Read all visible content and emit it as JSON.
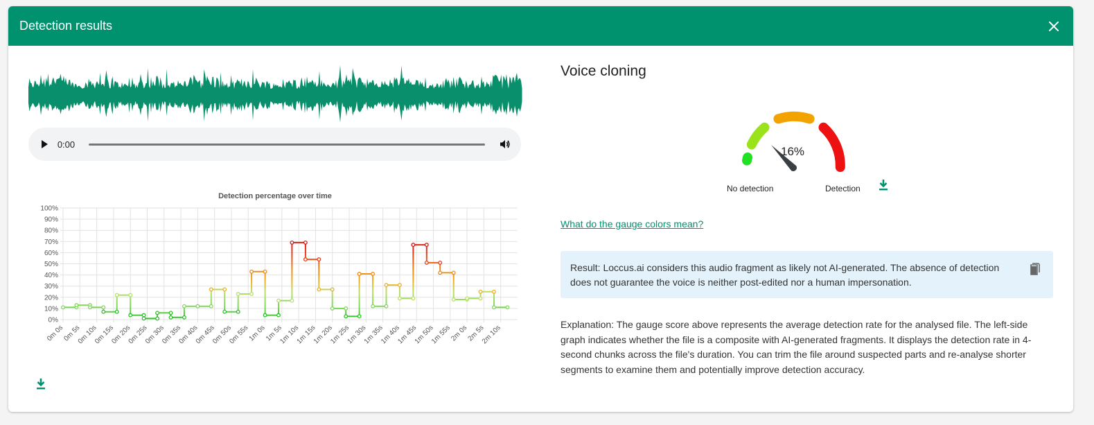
{
  "header": {
    "title": "Detection results",
    "close_icon": "close-icon"
  },
  "audio": {
    "time": "0:00",
    "play_icon": "play-icon",
    "volume_icon": "volume-icon",
    "progress": 0
  },
  "colors": {
    "brand": "#00916e",
    "waveform": "#0a8f6c",
    "result_bg": "#e3f2fb"
  },
  "chart_data": {
    "type": "line",
    "title": "Detection percentage over time",
    "xlabel": "",
    "ylabel": "",
    "ylim": [
      0,
      100
    ],
    "y_ticks": [
      "0%",
      "10%",
      "20%",
      "30%",
      "40%",
      "50%",
      "60%",
      "70%",
      "80%",
      "90%",
      "100%"
    ],
    "x_ticks": [
      "0m 0s",
      "0m 5s",
      "0m 10s",
      "0m 15s",
      "0m 20s",
      "0m 25s",
      "0m 30s",
      "0m 35s",
      "0m 40s",
      "0m 45s",
      "0m 50s",
      "0m 55s",
      "1m 0s",
      "1m 5s",
      "1m 10s",
      "1m 15s",
      "1m 20s",
      "1m 25s",
      "1m 30s",
      "1m 35s",
      "1m 40s",
      "1m 45s",
      "1m 50s",
      "1m 55s",
      "2m 0s",
      "2m 5s",
      "2m 10s"
    ],
    "grid": true,
    "style": "step",
    "x_max": 135,
    "chunk_seconds": 4,
    "values": [
      11,
      13,
      11,
      7,
      22,
      4,
      1,
      6,
      2,
      12,
      12,
      27,
      7,
      23,
      43,
      4,
      17,
      69,
      54,
      27,
      10,
      3,
      41,
      12,
      31,
      19,
      67,
      51,
      42,
      18,
      19,
      25,
      11
    ]
  },
  "detection": {
    "title": "Voice cloning",
    "percentage": "16%",
    "score": 16,
    "label_no": "No detection",
    "label_yes": "Detection",
    "download_icon": "download-icon",
    "link": "What do the gauge colors mean?",
    "result": "Result: Loccus.ai considers this audio fragment as likely not AI-generated. The absence of detection does not guarantee the voice is neither post-edited nor a human impersonation.",
    "copy_icon": "copy-icon",
    "explanation": "Explanation: The gauge score above represents the average detection rate for the analysed file. The left-side graph indicates whether the file is a composite with AI-generated fragments. It displays the detection rate in 4-second chunks across the file's duration. You can trim the file around suspected parts and re-analyse shorter segments to examine them and potentially improve detection accuracy."
  }
}
